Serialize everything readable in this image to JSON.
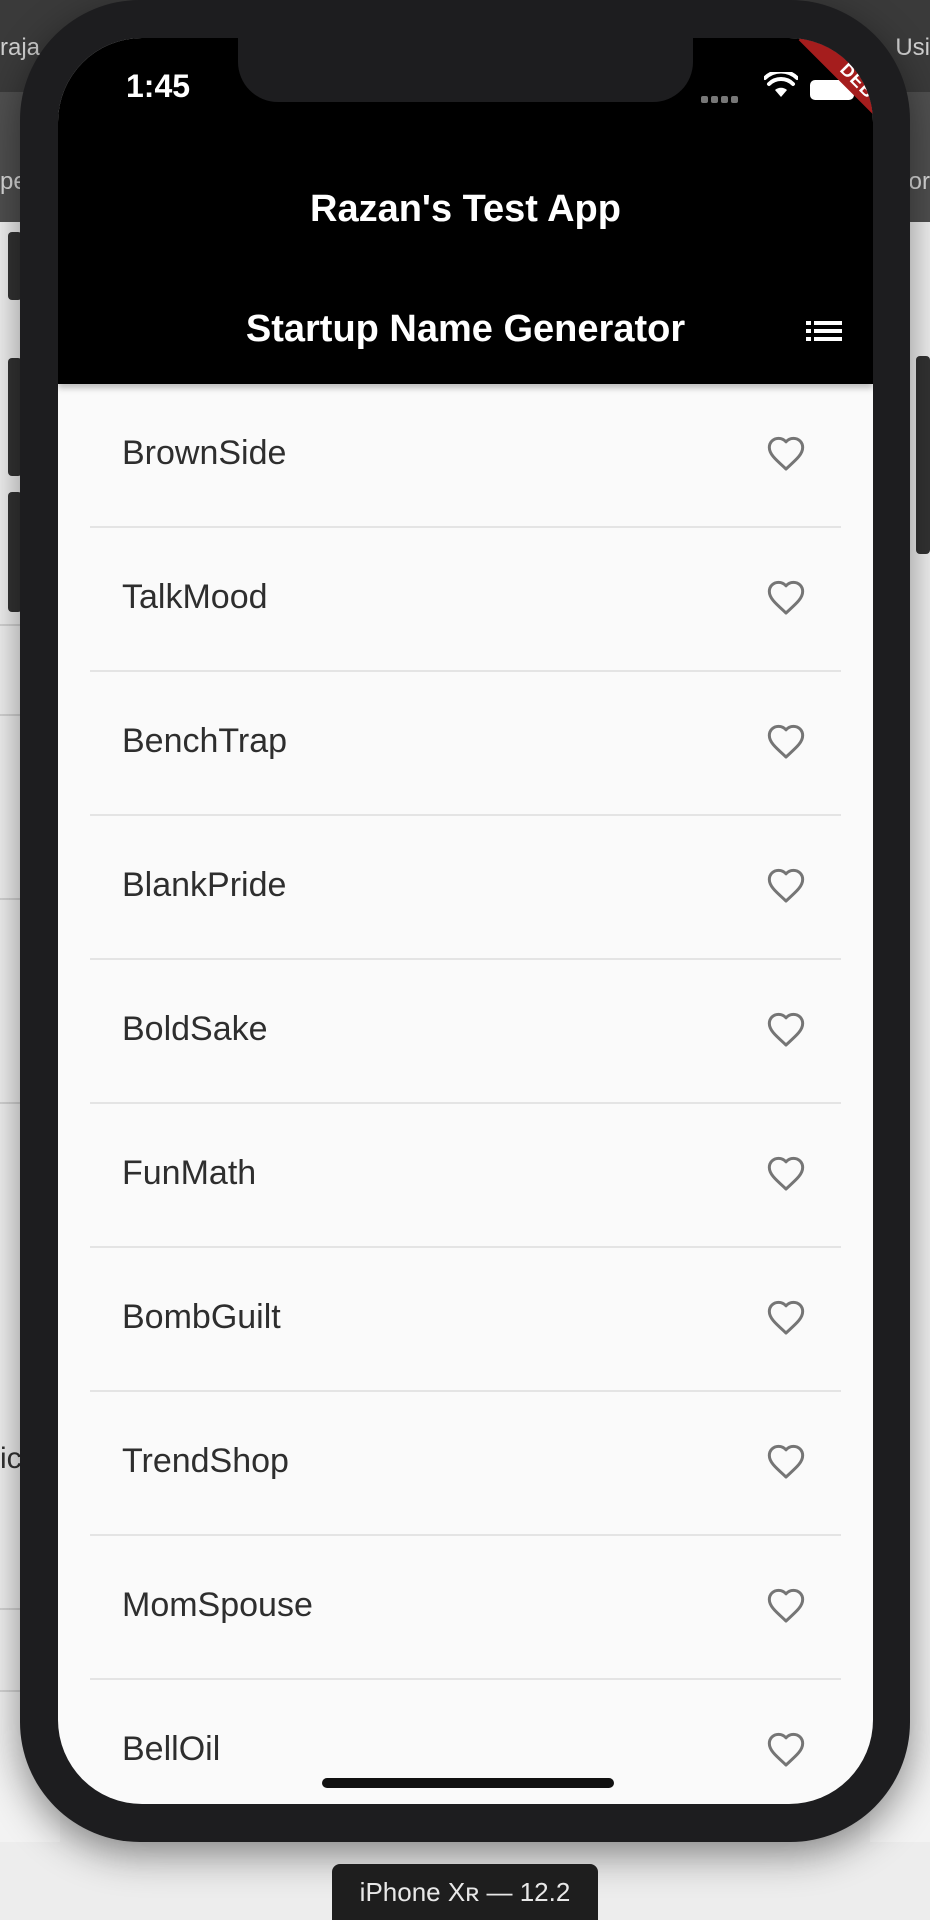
{
  "desktop": {
    "left_edge_top": "raja",
    "left_edge_mid": "pe",
    "left_edge_low": "ic",
    "right_edge_top": "Usi",
    "right_edge_mid": "or"
  },
  "status_bar": {
    "time": "1:45",
    "debug_label": "DEBUG"
  },
  "app": {
    "title": "Razan's Test App"
  },
  "page": {
    "title": "Startup Name Generator",
    "saved_list_icon": "list-icon"
  },
  "suggestions": [
    {
      "name": "BrownSide",
      "favorited": false
    },
    {
      "name": "TalkMood",
      "favorited": false
    },
    {
      "name": "BenchTrap",
      "favorited": false
    },
    {
      "name": "BlankPride",
      "favorited": false
    },
    {
      "name": "BoldSake",
      "favorited": false
    },
    {
      "name": "FunMath",
      "favorited": false
    },
    {
      "name": "BombGuilt",
      "favorited": false
    },
    {
      "name": "TrendShop",
      "favorited": false
    },
    {
      "name": "MomSpouse",
      "favorited": false
    },
    {
      "name": "BellOil",
      "favorited": false
    }
  ],
  "device": {
    "label": "iPhone Xʀ — 12.2"
  },
  "colors": {
    "app_bar": "#000000",
    "list_background": "#fafafa",
    "heart_outline": "#757575",
    "divider": "#e4e4e4"
  }
}
